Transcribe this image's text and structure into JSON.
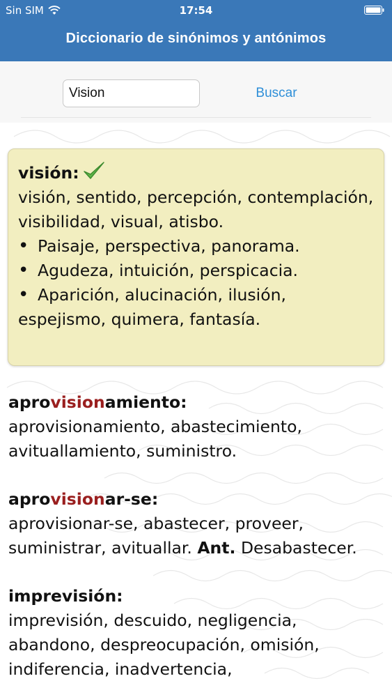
{
  "status_bar": {
    "carrier": "Sin SIM",
    "time": "17:54"
  },
  "header": {
    "title": "Diccionario de sinónimos y antónimos"
  },
  "search": {
    "value": "Vision",
    "button_label": "Buscar"
  },
  "main_result": {
    "headword": "visión:",
    "synonyms": "visión, sentido, percepción, contemplación, visibilidad, visual, atisbo.",
    "bullets": [
      "Paisaje, perspectiva, panorama.",
      "Agudeza, intuición, perspicacia.",
      "Aparición, alucinación, ilusión, espejismo, quimera, fantasía."
    ]
  },
  "related": [
    {
      "head_pre": "apro",
      "head_hl": "vision",
      "head_post": "amiento:",
      "text": "aprovisionamiento, abastecimiento, avituallamiento, suministro.",
      "ant_label": "",
      "ant_text": ""
    },
    {
      "head_pre": "apro",
      "head_hl": "vision",
      "head_post": "ar-se:",
      "text": "aprovisionar-se, abastecer, proveer, suministrar, avituallar.",
      "ant_label": "Ant.",
      "ant_text": "Desabastecer."
    },
    {
      "head_pre": "imprevisión:",
      "head_hl": "",
      "head_post": "",
      "text": "imprevisión, descuido, negligencia, abandono, despreocupación, omisión, indiferencia, inadvertencia,",
      "ant_label": "",
      "ant_text": ""
    }
  ],
  "colors": {
    "header_bg": "#3a78b8",
    "card_bg": "#f2eec0",
    "highlight": "#9a1f1f",
    "link": "#2f8fd8"
  }
}
